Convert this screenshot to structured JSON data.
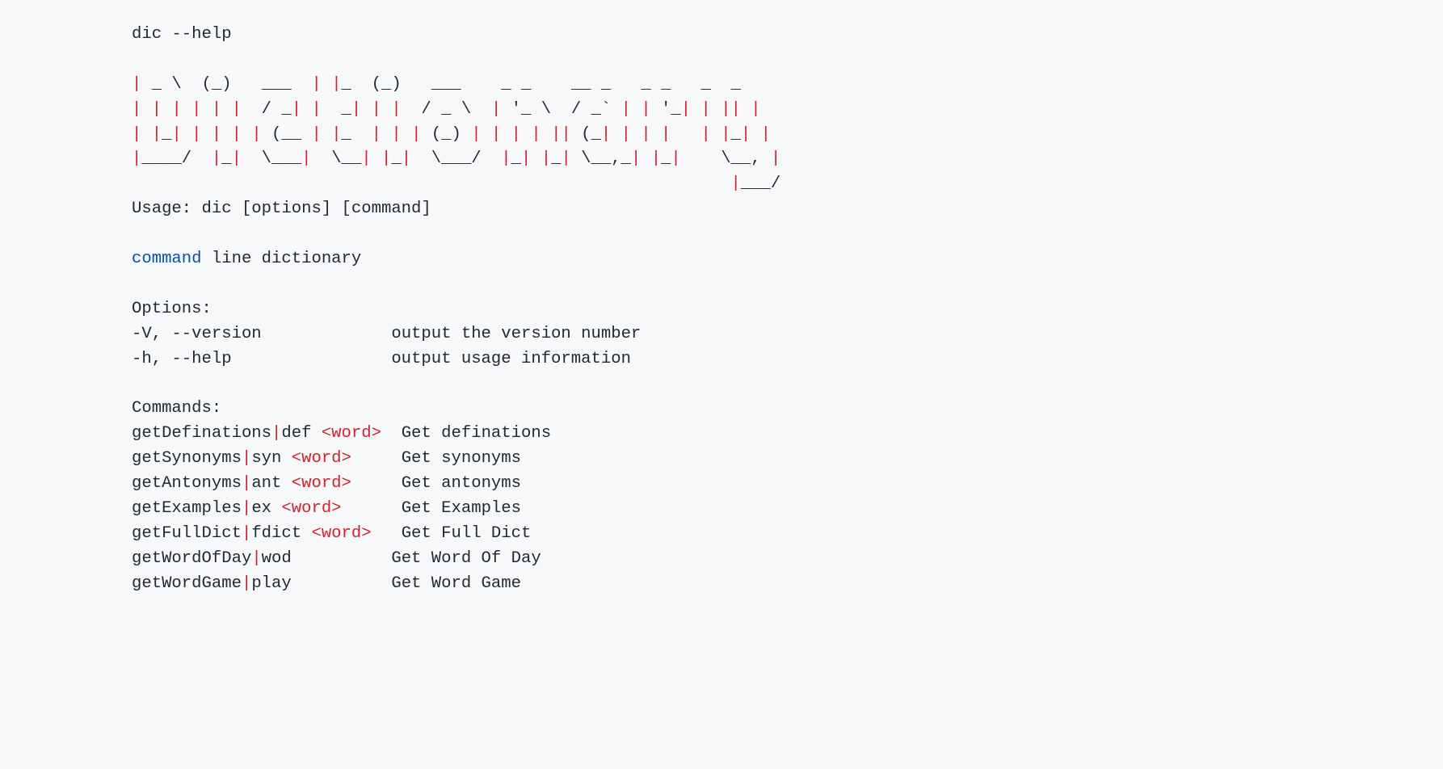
{
  "invocation": "dic --help",
  "ascii": {
    "l1": {
      "pre": "",
      "mid": "| _ \\  (_)   ___  | |_  (_)   ___    _ _    __ _   _ _   _  _",
      "post": ""
    },
    "l2": {
      "pre": "",
      "mid": "| | | | | |  / _| |  _| | |  / _ \\  | '_ \\  / _` | | '_| | || |",
      "post": ""
    },
    "l3": {
      "pre": "",
      "mid": "| |_| | | | | (__ | |_  | | | (_) | | | | || (_| | | |   | |_| |",
      "post": ""
    },
    "l4": {
      "pre": "",
      "mid": "|____/  |_|  \\___|  \\__| |_|  \\___/  |_| |_| \\__,_| |_|    \\__, |",
      "post": ""
    },
    "l5": {
      "pre": "",
      "mid": "                                                            |___/",
      "post": ""
    }
  },
  "usage": "Usage: dic [options] [command]",
  "desc_kw": "command",
  "desc_rest": " line dictionary",
  "options_header": "Options:",
  "opt1_flag": "-V, --version",
  "opt1_desc": "             output the version number",
  "opt2_flag": "-h, --help",
  "opt2_desc": "                output usage information",
  "commands_header": "Commands:",
  "cmd1_name": "getDefinations",
  "cmd1_alias": "def ",
  "cmd1_arg": "<word>",
  "cmd1_desc": "  Get definations",
  "cmd2_name": "getSynonyms",
  "cmd2_alias": "syn ",
  "cmd2_arg": "<word>",
  "cmd2_desc": "     Get synonyms",
  "cmd3_name": "getAntonyms",
  "cmd3_alias": "ant ",
  "cmd3_arg": "<word>",
  "cmd3_desc": "     Get antonyms",
  "cmd4_name": "getExamples",
  "cmd4_alias": "ex ",
  "cmd4_arg": "<word>",
  "cmd4_desc": "      Get Examples",
  "cmd5_name": "getFullDict",
  "cmd5_alias": "fdict ",
  "cmd5_arg": "<word>",
  "cmd5_desc": "   Get Full Dict",
  "cmd6_name": "getWordOfDay",
  "cmd6_alias": "wod",
  "cmd6_desc": "          Get Word Of Day",
  "cmd7_name": "getWordGame",
  "cmd7_alias": "play",
  "cmd7_desc": "          Get Word Game",
  "pipe": "|"
}
